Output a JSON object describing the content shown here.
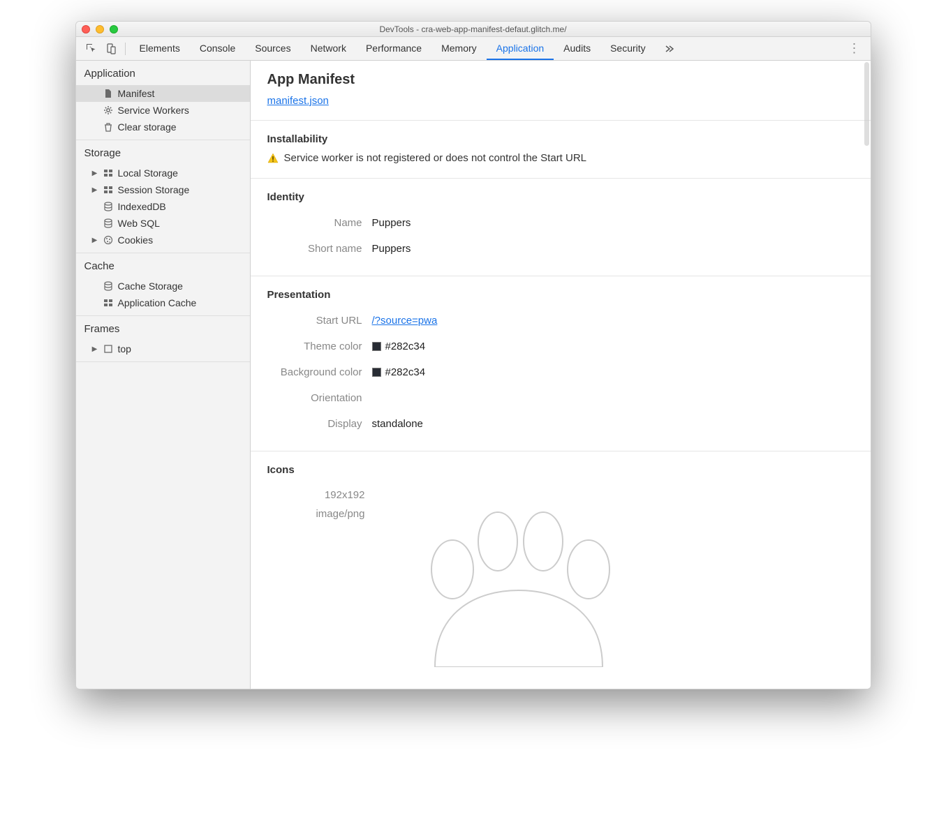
{
  "window": {
    "title": "DevTools - cra-web-app-manifest-defaut.glitch.me/"
  },
  "toolbar": {
    "tabs": [
      "Elements",
      "Console",
      "Sources",
      "Network",
      "Performance",
      "Memory",
      "Application",
      "Audits",
      "Security"
    ],
    "active_tab": "Application"
  },
  "sidebar": {
    "groups": [
      {
        "title": "Application",
        "items": [
          {
            "icon": "file",
            "label": "Manifest",
            "selected": true,
            "expandable": false
          },
          {
            "icon": "gear",
            "label": "Service Workers",
            "selected": false,
            "expandable": false
          },
          {
            "icon": "trash",
            "label": "Clear storage",
            "selected": false,
            "expandable": false
          }
        ]
      },
      {
        "title": "Storage",
        "items": [
          {
            "icon": "grid",
            "label": "Local Storage",
            "selected": false,
            "expandable": true
          },
          {
            "icon": "grid",
            "label": "Session Storage",
            "selected": false,
            "expandable": true
          },
          {
            "icon": "db",
            "label": "IndexedDB",
            "selected": false,
            "expandable": false
          },
          {
            "icon": "db",
            "label": "Web SQL",
            "selected": false,
            "expandable": false
          },
          {
            "icon": "cookie",
            "label": "Cookies",
            "selected": false,
            "expandable": true
          }
        ]
      },
      {
        "title": "Cache",
        "items": [
          {
            "icon": "db",
            "label": "Cache Storage",
            "selected": false,
            "expandable": false
          },
          {
            "icon": "grid",
            "label": "Application Cache",
            "selected": false,
            "expandable": false
          }
        ]
      },
      {
        "title": "Frames",
        "items": [
          {
            "icon": "frame",
            "label": "top",
            "selected": false,
            "expandable": true
          }
        ]
      }
    ]
  },
  "main": {
    "title": "App Manifest",
    "manifest_link": "manifest.json",
    "installability": {
      "heading": "Installability",
      "warning": "Service worker is not registered or does not control the Start URL"
    },
    "identity": {
      "heading": "Identity",
      "rows": [
        {
          "label": "Name",
          "value": "Puppers"
        },
        {
          "label": "Short name",
          "value": "Puppers"
        }
      ]
    },
    "presentation": {
      "heading": "Presentation",
      "rows": [
        {
          "label": "Start URL",
          "value": "/?source=pwa",
          "link": true
        },
        {
          "label": "Theme color",
          "value": "#282c34",
          "swatch": "#282c34"
        },
        {
          "label": "Background color",
          "value": "#282c34",
          "swatch": "#282c34"
        },
        {
          "label": "Orientation",
          "value": ""
        },
        {
          "label": "Display",
          "value": "standalone"
        }
      ]
    },
    "icons": {
      "heading": "Icons",
      "size": "192x192",
      "mime": "image/png"
    }
  }
}
